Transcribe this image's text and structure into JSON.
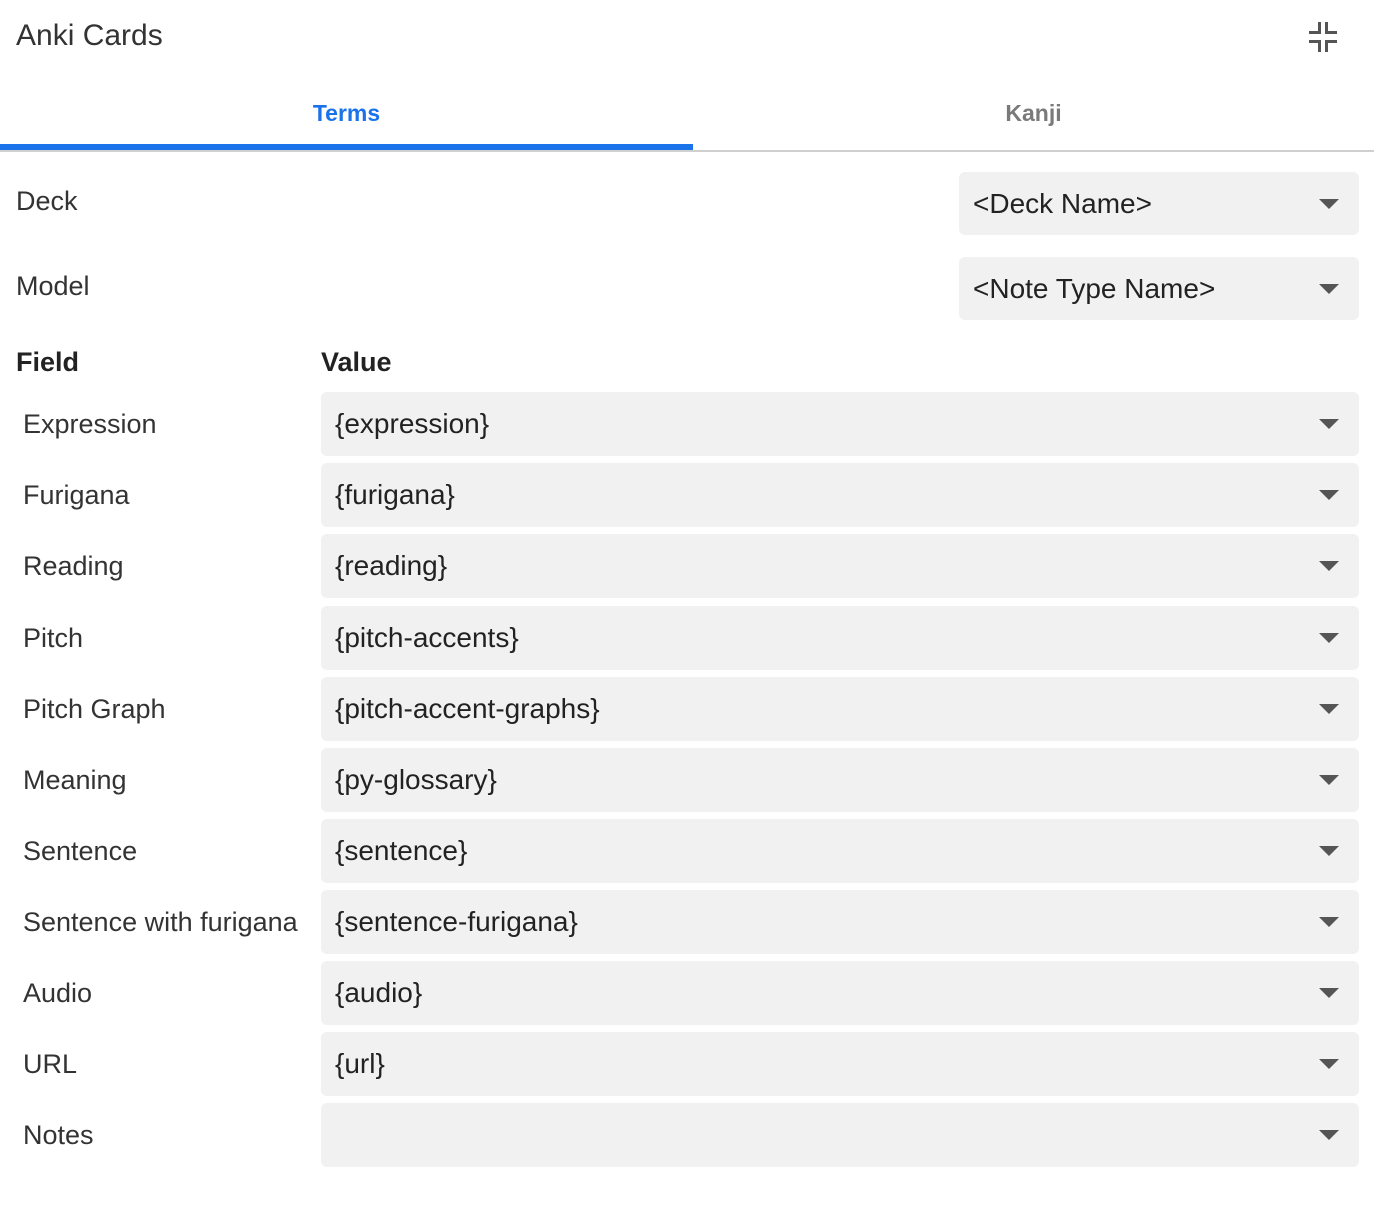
{
  "header": {
    "title": "Anki Cards",
    "collapse_icon": "collapse-icon"
  },
  "tabs": [
    {
      "label": "Terms",
      "active": true
    },
    {
      "label": "Kanji",
      "active": false
    }
  ],
  "colors": {
    "accent": "#1a73e8",
    "inactive_tab": "#7a7a7a",
    "select_bg": "#f1f1f1"
  },
  "deck": {
    "label": "Deck",
    "value": "<Deck Name>"
  },
  "model": {
    "label": "Model",
    "value": "<Note Type Name>"
  },
  "table": {
    "field_header": "Field",
    "value_header": "Value",
    "rows": [
      {
        "field": "Expression",
        "value": "{expression}"
      },
      {
        "field": "Furigana",
        "value": "{furigana}"
      },
      {
        "field": "Reading",
        "value": "{reading}"
      },
      {
        "field": "Pitch",
        "value": "{pitch-accents}"
      },
      {
        "field": "Pitch Graph",
        "value": "{pitch-accent-graphs}"
      },
      {
        "field": "Meaning",
        "value": "{py-glossary}"
      },
      {
        "field": "Sentence",
        "value": "{sentence}"
      },
      {
        "field": "Sentence with furigana",
        "value": "{sentence-furigana}"
      },
      {
        "field": "Audio",
        "value": "{audio}"
      },
      {
        "field": "URL",
        "value": "{url}"
      },
      {
        "field": "Notes",
        "value": ""
      }
    ]
  }
}
